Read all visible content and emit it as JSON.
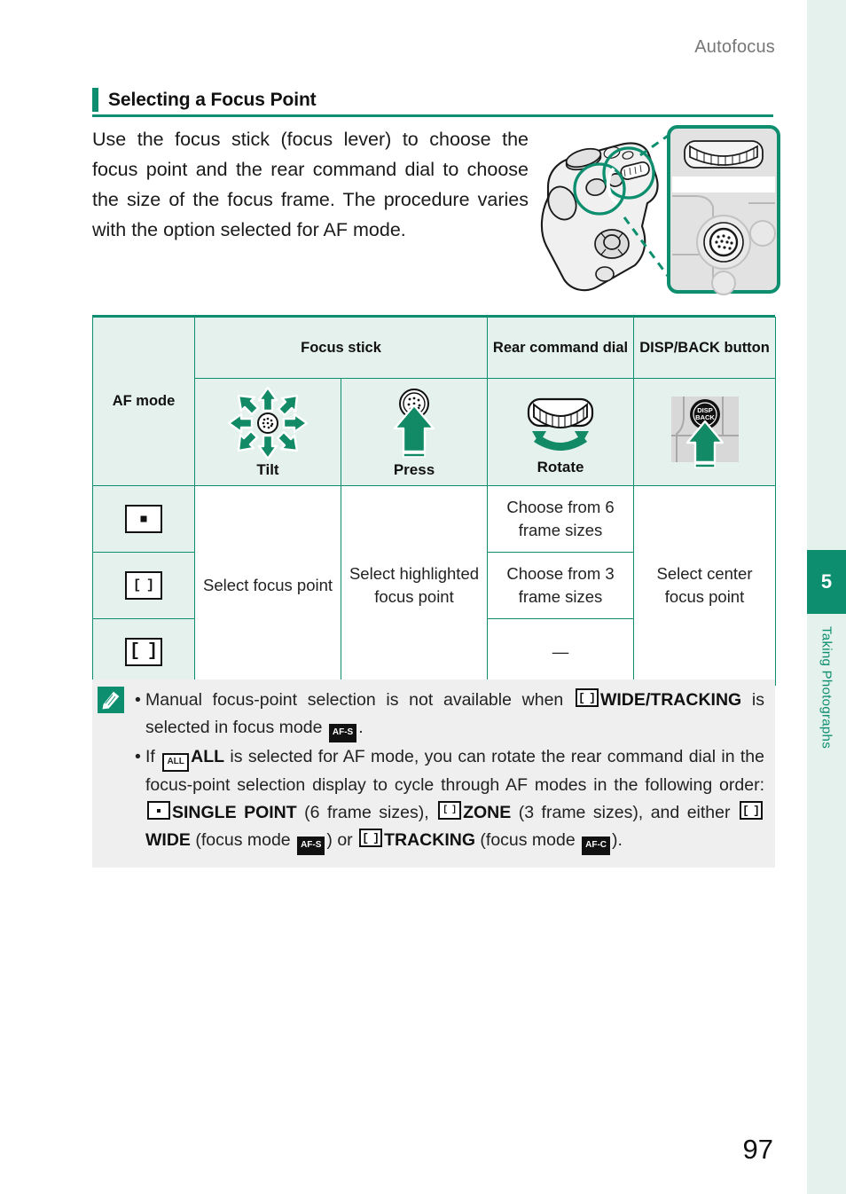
{
  "running_head": "Autofocus",
  "section": {
    "title": "Selecting a Focus Point"
  },
  "intro": "Use the focus stick (focus lever) to choose the focus point and the rear command dial to choose the size of the focus frame. The procedure varies with the option selected for AF mode.",
  "figure": {
    "name": "camera-rear-controls-illustration",
    "callout_label": "focus-stick-and-rear-command-dial-detail"
  },
  "table": {
    "headers": {
      "af_mode": "AF mode",
      "focus_stick": "Focus stick",
      "rear_command_dial": "Rear command dial",
      "disp_back_button": "DISP/BACK button"
    },
    "actions": {
      "tilt": "Tilt",
      "press": "Press",
      "rotate": "Rotate",
      "disp_back": ""
    },
    "rows": [
      {
        "af_mode_icon": "single-point",
        "focus_stick_tilt": "Select focus point",
        "focus_stick_press": "Select highlighted focus point",
        "rear_command_dial": "Choose from 6 frame sizes",
        "disp_back": "Select center focus point"
      },
      {
        "af_mode_icon": "zone",
        "rear_command_dial": "Choose from 3 frame sizes"
      },
      {
        "af_mode_icon": "wide-tracking",
        "rear_command_dial": "—"
      }
    ]
  },
  "note": {
    "icon": "note-pencil-icon",
    "bullets": [
      {
        "parts": [
          {
            "type": "text",
            "value": "Manual focus-point selection is not available when "
          },
          {
            "type": "icon",
            "value": "wide-tracking-box"
          },
          {
            "type": "bold",
            "value": "WIDE/TRACKING"
          },
          {
            "type": "text",
            "value": " is selected in focus mode "
          },
          {
            "type": "icon",
            "value": "AF-S"
          },
          {
            "type": "text",
            "value": "."
          }
        ]
      },
      {
        "parts": [
          {
            "type": "text",
            "value": "If "
          },
          {
            "type": "icon",
            "value": "ALL"
          },
          {
            "type": "bold",
            "value": "ALL"
          },
          {
            "type": "text",
            "value": " is selected for AF mode, you can rotate the rear command dial in the focus-point selection display to cycle through AF modes in the following order: "
          },
          {
            "type": "icon",
            "value": "single-point-box"
          },
          {
            "type": "bold",
            "value": "SINGLE POINT"
          },
          {
            "type": "text",
            "value": " (6 frame sizes), "
          },
          {
            "type": "icon",
            "value": "zone-box"
          },
          {
            "type": "bold",
            "value": "ZONE"
          },
          {
            "type": "text",
            "value": " (3 frame sizes), and either "
          },
          {
            "type": "icon",
            "value": "wide-box"
          },
          {
            "type": "bold",
            "value": "WIDE"
          },
          {
            "type": "text",
            "value": " (focus mode "
          },
          {
            "type": "icon",
            "value": "AF-S"
          },
          {
            "type": "text",
            "value": ") or "
          },
          {
            "type": "icon",
            "value": "tracking-box"
          },
          {
            "type": "bold",
            "value": "TRACKING"
          },
          {
            "type": "text",
            "value": " (focus mode "
          },
          {
            "type": "icon",
            "value": "AF-C"
          },
          {
            "type": "text",
            "value": ")."
          }
        ]
      }
    ],
    "bullet1_text": "Manual focus-point selection is not available when WIDE/TRACKING is selected in focus mode AF-S.",
    "bullet2_text": "If ALL is selected for AF mode, you can rotate the rear command dial in the focus-point selection display to cycle through AF modes in the following order: SINGLE POINT (6 frame sizes), ZONE (3 frame sizes), and either WIDE (focus mode AF-S) or TRACKING (focus mode AF-C)."
  },
  "chapter_tab": {
    "number": "5",
    "label": "Taking Photographs"
  },
  "folio": "97",
  "colors": {
    "accent_green": "#0d8f6f",
    "table_header_bg": "#e4f1ec",
    "note_bg": "#efefef",
    "running_head": "#777777"
  },
  "icon_labels": {
    "disp_back_button_face": "DISP BACK",
    "af_s": "AF-S",
    "af_c": "AF-C",
    "all": "ALL"
  }
}
